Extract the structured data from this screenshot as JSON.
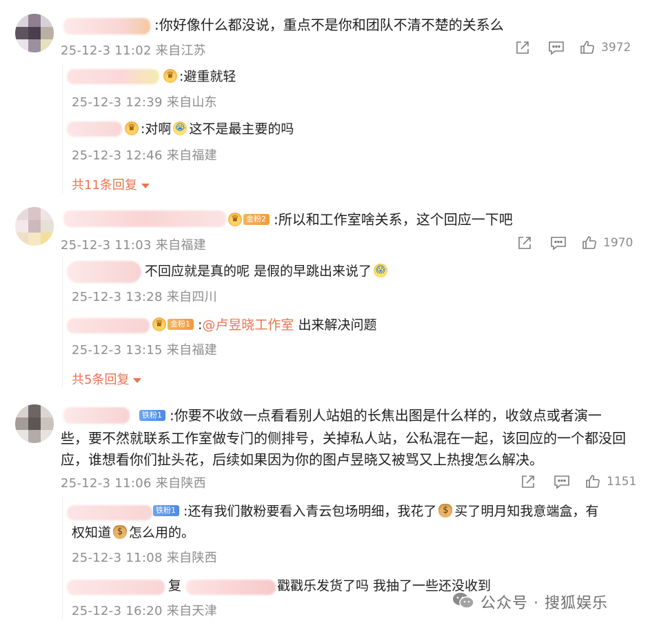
{
  "comments": [
    {
      "text": ":你好像什么都没说，重点不是你和团队不清不楚的关系么",
      "meta": "25-12-3 11:02 来自江苏",
      "likes": "3972",
      "replies": [
        {
          "text": ":避重就轻",
          "meta": "25-12-3 12:39 来自山东"
        },
        {
          "text_a": ":对啊",
          "text_b": "这不是最主要的吗",
          "meta": "25-12-3 12:46 来自福建"
        }
      ],
      "more": "共11条回复"
    },
    {
      "badge": "金粉2",
      "text": ":所以和工作室啥关系，这个回应一下吧",
      "meta": "25-12-3 11:03 来自福建",
      "likes": "1970",
      "replies": [
        {
          "text": "不回应就是真的呢 是假的早跳出来说了",
          "meta": "25-12-3 13:28 来自四川"
        },
        {
          "badge": "金粉1",
          "prefix": ":",
          "mention": "@卢昱晓工作室",
          "text": " 出来解决问题",
          "meta": "25-12-3 13:15 来自福建"
        }
      ],
      "more": "共5条回复"
    },
    {
      "badge": "铁粉1",
      "text_line1": ":你要不收敛一点看看别人站姐的长焦出图是什么样的，收敛点或者演一",
      "text_line2": "些，要不然就联系工作室做专门的侧排号，关掉私人站，公私混在一起，该回应的一个都没回",
      "text_line3": "应，谁想看你们扯头花，后续如果因为你的图卢昱晓又被骂又上热搜怎么解决。",
      "meta": "25-12-3 11:06 来自陕西",
      "likes": "1151",
      "replies": [
        {
          "badge": "铁粉1",
          "text_a": ":还有我们散粉要看入青云包场明细，我花了",
          "text_b": "买了明月知我意端盒，有",
          "text_c": "权知道",
          "text_d": "怎么用的。",
          "meta": "25-12-3 11:08 来自陕西"
        },
        {
          "reply_word": "复",
          "text": "戳戳乐发货了吗 我抽了一些还没收到",
          "meta": "25-12-3 16:20 来自天津"
        }
      ]
    }
  ],
  "watermark": "公众号 · 搜狐娱乐"
}
